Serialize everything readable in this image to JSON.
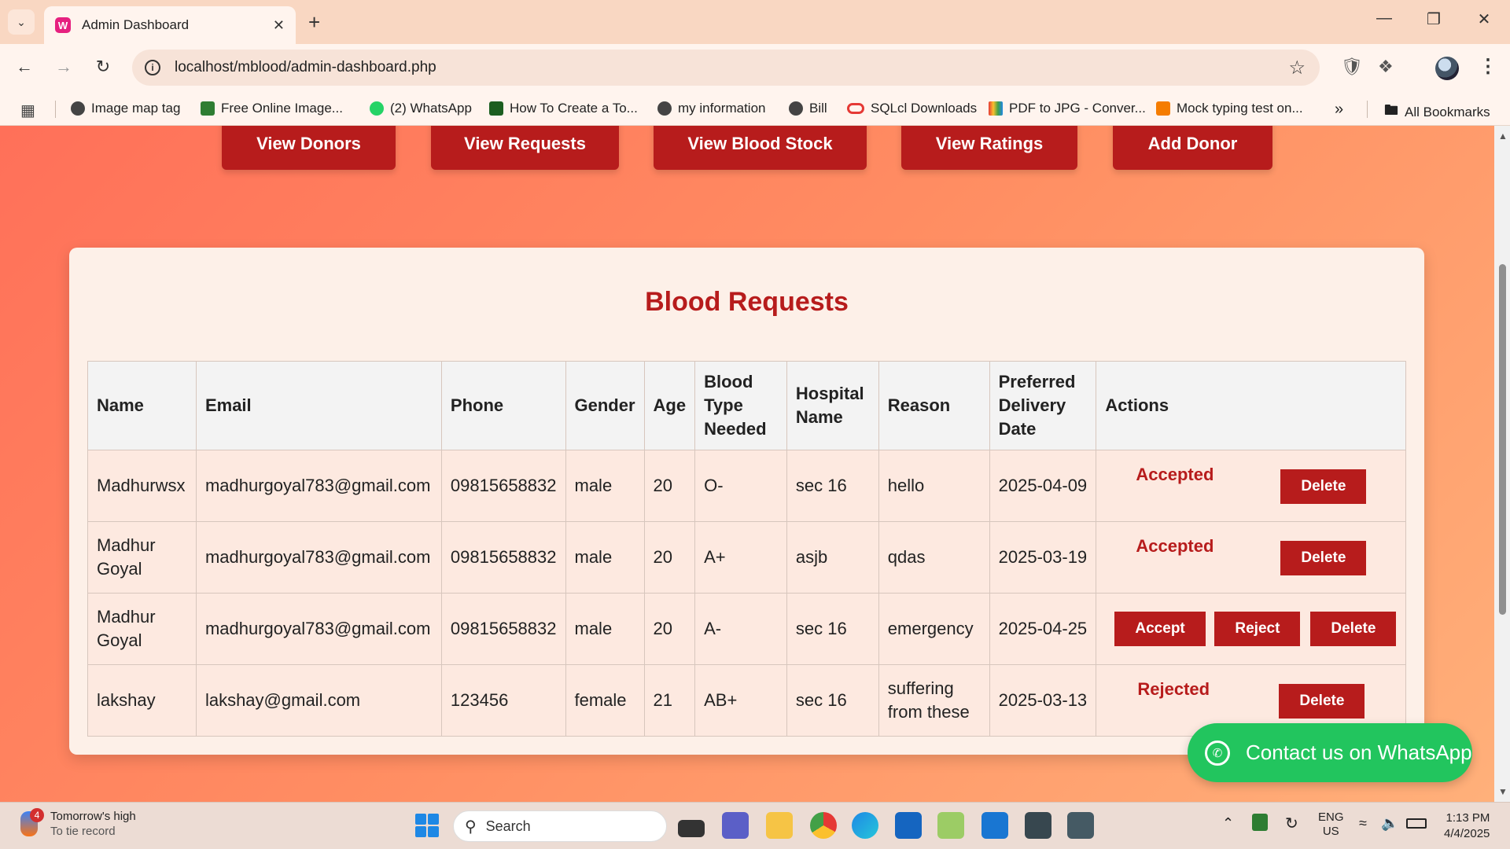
{
  "browser": {
    "tab_title": "Admin Dashboard",
    "url": "localhost/mblood/admin-dashboard.php",
    "bookmarks": [
      "Image map tag",
      "Free Online Image...",
      "(2) WhatsApp",
      "How To Create a To...",
      "my information",
      "Bill",
      "SQLcl Downloads",
      "PDF to JPG - Conver...",
      "Mock typing test on..."
    ],
    "all_bookmarks": "All Bookmarks",
    "overflow": "»"
  },
  "nav": {
    "view_donors": "View Donors",
    "view_requests": "View Requests",
    "view_blood_stock": "View Blood Stock",
    "view_ratings": "View Ratings",
    "add_donor": "Add Donor"
  },
  "requests": {
    "title": "Blood Requests",
    "columns": [
      "Name",
      "Email",
      "Phone",
      "Gender",
      "Age",
      "Blood Type Needed",
      "Hospital Name",
      "Reason",
      "Preferred Delivery Date",
      "Actions"
    ],
    "rows": [
      {
        "name": "Madhurwsx",
        "email": "madhurgoyal783@gmail.com",
        "phone": "09815658832",
        "gender": "male",
        "age": "20",
        "blood": "O-",
        "hospital": "sec 16",
        "reason": "hello",
        "date": "2025-04-09",
        "status": "Accepted"
      },
      {
        "name": "Madhur Goyal",
        "email": "madhurgoyal783@gmail.com",
        "phone": "09815658832",
        "gender": "male",
        "age": "20",
        "blood": "A+",
        "hospital": "asjb",
        "reason": "qdas",
        "date": "2025-03-19",
        "status": "Accepted"
      },
      {
        "name": "Madhur Goyal",
        "email": "madhurgoyal783@gmail.com",
        "phone": "09815658832",
        "gender": "male",
        "age": "20",
        "blood": "A-",
        "hospital": "sec 16",
        "reason": "emergency",
        "date": "2025-04-25",
        "status": ""
      },
      {
        "name": "lakshay",
        "email": "lakshay@gmail.com",
        "phone": "123456",
        "gender": "female",
        "age": "21",
        "blood": "AB+",
        "hospital": "sec 16",
        "reason": "suffering from these",
        "date": "2025-03-13",
        "status": "Rejected"
      }
    ],
    "accept_label": "Accept",
    "reject_label": "Reject",
    "delete_label": "Delete"
  },
  "whatsapp": {
    "label": "Contact us on WhatsApp"
  },
  "taskbar": {
    "weather_title": "Tomorrow's high",
    "weather_sub": "To tie record",
    "weather_badge": "4",
    "search_label": "Search",
    "lang_top": "ENG",
    "lang_bottom": "US",
    "time": "1:13 PM",
    "date": "4/4/2025"
  },
  "colors": {
    "accent": "#b71c1c",
    "whatsapp": "#22c55e"
  }
}
